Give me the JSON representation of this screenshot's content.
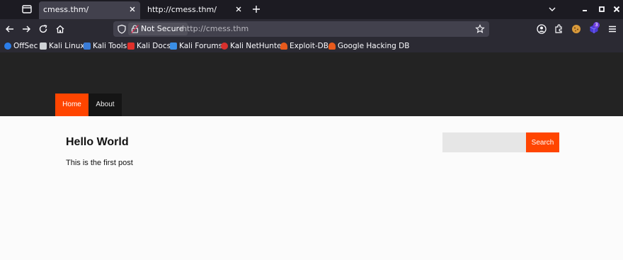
{
  "browser": {
    "tabs": [
      {
        "title": "cmess.thm/"
      },
      {
        "title": "http://cmess.thm/"
      }
    ],
    "security_label": "Not Secure",
    "url": "http://cmess.thm",
    "extension_badge": "3",
    "bookmarks": [
      {
        "label": "OffSec",
        "icon": "offsec-icon",
        "color": "#2b7de9"
      },
      {
        "label": "Kali Linux",
        "icon": "kali-dragon-icon",
        "color": "#cfd2d6"
      },
      {
        "label": "Kali Tools",
        "icon": "kali-tools-icon",
        "color": "#3a7bd5"
      },
      {
        "label": "Kali Docs",
        "icon": "kali-docs-icon",
        "color": "#e0302a"
      },
      {
        "label": "Kali Forums",
        "icon": "kali-forums-icon",
        "color": "#3a8ee6"
      },
      {
        "label": "Kali NetHunter",
        "icon": "nethunter-icon",
        "color": "#d8302d"
      },
      {
        "label": "Exploit-DB",
        "icon": "exploit-db-icon",
        "color": "#e85a1c"
      },
      {
        "label": "Google Hacking DB",
        "icon": "ghdb-icon",
        "color": "#e85a1c"
      }
    ]
  },
  "site": {
    "nav": {
      "home": "Home",
      "about": "About"
    },
    "post": {
      "title": "Hello World",
      "body": "This is the first post"
    },
    "search": {
      "button": "Search",
      "value": ""
    },
    "accent_color": "#ff4500"
  }
}
